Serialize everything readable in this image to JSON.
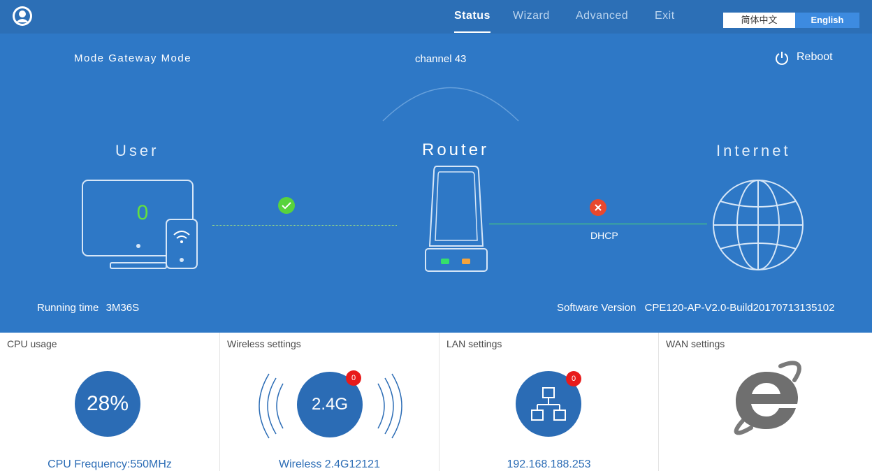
{
  "nav": {
    "tabs": [
      {
        "label": "Status"
      },
      {
        "label": "Wizard"
      },
      {
        "label": "Advanced"
      },
      {
        "label": "Exit"
      }
    ],
    "lang_cn": "简体中文",
    "lang_en": "English"
  },
  "status": {
    "mode_label": "Mode",
    "mode_value": "Gateway Mode",
    "channel_label": "channel",
    "channel_value": "43",
    "reboot_label": "Reboot",
    "user_title": "User",
    "router_title": "Router",
    "internet_title": "Internet",
    "user_count": "0",
    "wan_protocol": "DHCP",
    "running_time_label": "Running time",
    "running_time_value": "3M36S",
    "software_version_label": "Software Version",
    "software_version_value": "CPE120-AP-V2.0-Build20170713135102"
  },
  "panels": {
    "cpu": {
      "title": "CPU usage",
      "value": "28%",
      "footer": "CPU Frequency:550MHz"
    },
    "wireless": {
      "title": "Wireless settings",
      "band": "2.4G",
      "badge": "0",
      "footer": "Wireless 2.4G12121"
    },
    "lan": {
      "title": "LAN settings",
      "badge": "0",
      "footer": "192.168.188.253"
    },
    "wan": {
      "title": "WAN settings"
    }
  },
  "colors": {
    "topbar": "#2c6fb6",
    "hero": "#2e78c6",
    "accent_blue": "#2b6cb5",
    "ok_green": "#58d33d",
    "error_red": "#e8482e",
    "badge_red": "#e81b1b"
  },
  "icons": {
    "logo": "user-circle-icon",
    "reboot": "power-icon",
    "user_device": "monitor-phone-icon",
    "wifi": "wifi-icon",
    "router": "router-icon",
    "internet": "globe-icon",
    "ok": "check-icon",
    "error": "close-icon",
    "lan": "network-topology-icon",
    "wan": "internet-explorer-icon"
  }
}
